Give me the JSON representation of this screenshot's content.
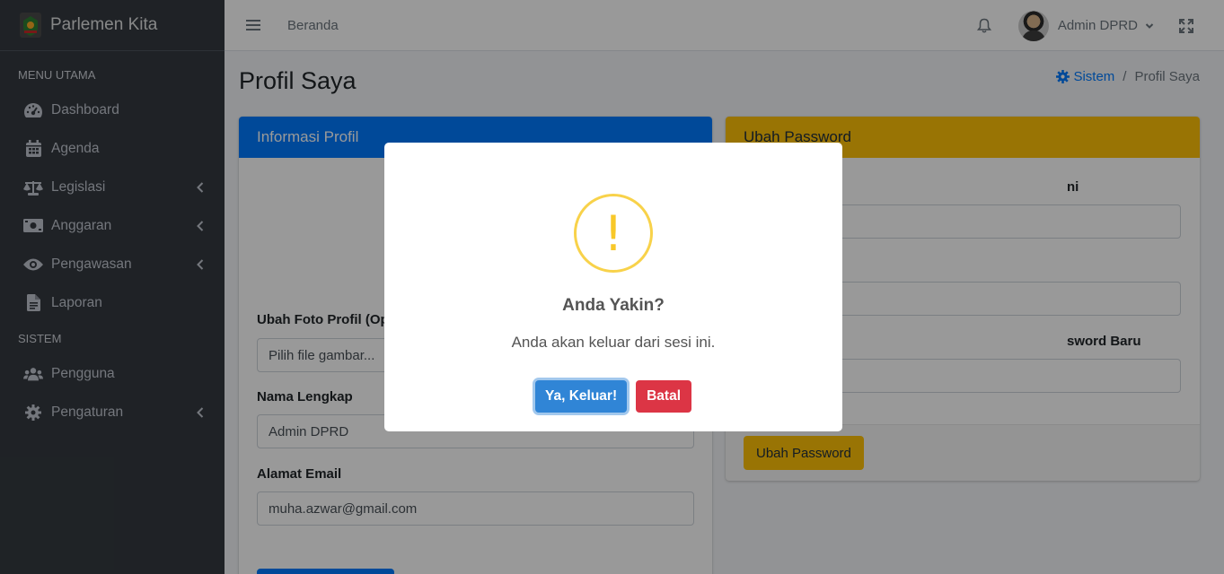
{
  "app": {
    "brand": "Parlemen Kita"
  },
  "sidebar": {
    "headers": {
      "main": "MENU UTAMA",
      "system": "SISTEM"
    },
    "items": [
      {
        "label": "Dashboard",
        "icon": "tachometer-icon"
      },
      {
        "label": "Agenda",
        "icon": "calendar-icon"
      },
      {
        "label": "Legislasi",
        "icon": "balance-scale-icon"
      },
      {
        "label": "Anggaran",
        "icon": "money-bill-icon"
      },
      {
        "label": "Pengawasan",
        "icon": "eye-icon"
      },
      {
        "label": "Laporan",
        "icon": "file-icon"
      },
      {
        "label": "Pengguna",
        "icon": "users-icon"
      },
      {
        "label": "Pengaturan",
        "icon": "cog-icon"
      }
    ]
  },
  "topbar": {
    "home_link": "Beranda",
    "user_name": "Admin DPRD"
  },
  "page": {
    "title": "Profil Saya",
    "breadcrumb": {
      "parent": "Sistem",
      "current": "Profil Saya"
    }
  },
  "profile_card": {
    "title": "Informasi Profil",
    "photo_label": "Ubah Foto Profil (Op",
    "photo_placeholder": "Pilih file gambar...",
    "name_label": "Nama Lengkap",
    "name_value": "Admin DPRD",
    "email_label": "Alamat Email",
    "email_value": "muha.azwar@gmail.com"
  },
  "password_card": {
    "title": "Ubah Password",
    "current_label_tail": "ni",
    "confirm_label_tail": "sword Baru",
    "submit_label": "Ubah Password"
  },
  "dialog": {
    "title": "Anda Yakin?",
    "message": "Anda akan keluar dari sesi ini.",
    "confirm_label": "Ya, Keluar!",
    "cancel_label": "Batal",
    "icon": "!"
  },
  "colors": {
    "primary": "#007bff",
    "warning": "#ffc107",
    "sidebar": "#343a40",
    "confirm": "#3085d6",
    "cancel": "#dc3545",
    "alert": "#f8c829"
  }
}
